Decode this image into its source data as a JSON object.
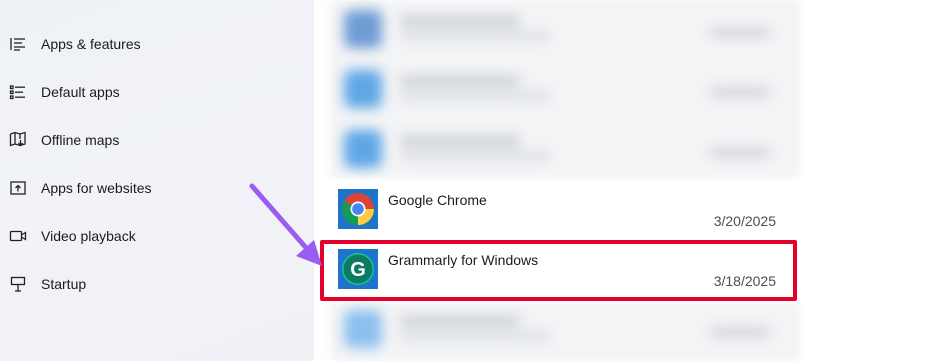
{
  "sidebar": {
    "items": [
      {
        "label": "Apps & features",
        "icon": "apps-features-icon"
      },
      {
        "label": "Default apps",
        "icon": "default-apps-icon"
      },
      {
        "label": "Offline maps",
        "icon": "offline-maps-icon"
      },
      {
        "label": "Apps for websites",
        "icon": "apps-for-websites-icon"
      },
      {
        "label": "Video playback",
        "icon": "video-playback-icon"
      },
      {
        "label": "Startup",
        "icon": "startup-icon"
      }
    ]
  },
  "apps": [
    {
      "name": "Google Chrome",
      "date": "3/20/2025",
      "icon": "chrome-icon"
    },
    {
      "name": "Grammarly for Windows",
      "date": "3/18/2025",
      "icon": "grammarly-icon"
    }
  ],
  "annotation": {
    "highlight_color": "#e4002b",
    "arrow_color": "#9b5cf0"
  }
}
